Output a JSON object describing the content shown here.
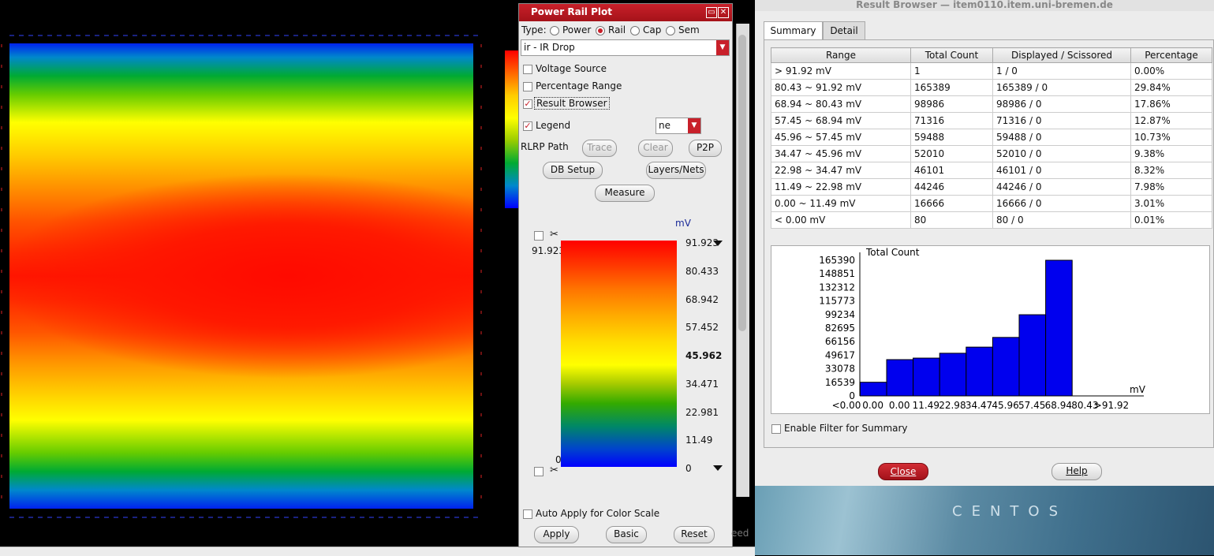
{
  "prp": {
    "title": "Power Rail Plot",
    "type_label": "Type:",
    "type_options": [
      "Power",
      "Rail",
      "Cap",
      "Sem"
    ],
    "type_selected": "Rail",
    "analysis_select": "ir - IR Drop",
    "voltage_source": "Voltage Source",
    "percentage_range": "Percentage Range",
    "result_browser": "Result Browser",
    "legend": "Legend",
    "legend_select": "ne",
    "rlrp_path": "RLRP Path",
    "trace": "Trace",
    "clear": "Clear",
    "p2p": "P2P",
    "db_setup": "DB Setup",
    "layers_nets": "Layers/Nets",
    "measure": "Measure",
    "unit": "mV",
    "max_value": "91.923",
    "min_value": "0",
    "ticks": [
      "91.923",
      "80.433",
      "68.942",
      "57.452",
      "45.962",
      "34.471",
      "22.981",
      "11.49",
      "0"
    ],
    "auto_apply": "Auto Apply for Color Scale",
    "apply": "Apply",
    "basic": "Basic",
    "reset": "Reset",
    "behind_text": "eed"
  },
  "rb": {
    "title": "Result Browser — item0110.item.uni-bremen.de",
    "tabs": [
      "Summary",
      "Detail"
    ],
    "headers": [
      "Range",
      "Total Count",
      "Displayed / Scissored",
      "Percentage"
    ],
    "rows": [
      [
        "> 91.92 mV",
        "1",
        "1 / 0",
        "0.00%"
      ],
      [
        "80.43 ~ 91.92 mV",
        "165389",
        "165389 / 0",
        "29.84%"
      ],
      [
        "68.94 ~ 80.43 mV",
        "98986",
        "98986 / 0",
        "17.86%"
      ],
      [
        "57.45 ~ 68.94 mV",
        "71316",
        "71316 / 0",
        "12.87%"
      ],
      [
        "45.96 ~ 57.45 mV",
        "59488",
        "59488 / 0",
        "10.73%"
      ],
      [
        "34.47 ~ 45.96 mV",
        "52010",
        "52010 / 0",
        "9.38%"
      ],
      [
        "22.98 ~ 34.47 mV",
        "46101",
        "46101 / 0",
        "8.32%"
      ],
      [
        "11.49 ~ 22.98 mV",
        "44246",
        "44246 / 0",
        "7.98%"
      ],
      [
        "0.00 ~ 11.49 mV",
        "16666",
        "16666 / 0",
        "3.01%"
      ],
      [
        "< 0.00 mV",
        "80",
        "80 / 0",
        "0.01%"
      ]
    ],
    "enable_filter": "Enable Filter for Summary",
    "close": "Close",
    "help": "Help",
    "desktop_brand": "CENTOS"
  },
  "chart_data": {
    "type": "bar",
    "ylabel": "Total Count",
    "xlabel": "mV",
    "yticks": [
      0,
      16539,
      33078,
      49617,
      66156,
      82695,
      99234,
      115773,
      132312,
      148851,
      165390
    ],
    "ylim": [
      0,
      165390
    ],
    "x_tick_labels": [
      "<0.00",
      "0.00",
      "0.00",
      "11.49",
      "22.98",
      "34.47",
      "45.96",
      "57.45",
      "68.94",
      "80.43",
      ">91.92"
    ],
    "categories": [
      "0.00~0.00",
      "0.00~11.49",
      "11.49~22.98",
      "22.98~34.47",
      "34.47~45.96",
      "45.96~57.45",
      "57.45~68.94",
      "68.94~80.43",
      "80.43~91.92"
    ],
    "values": [
      16666,
      44246,
      46101,
      52010,
      59488,
      71316,
      98986,
      165389,
      0
    ],
    "bar_color": "#0000ee"
  }
}
